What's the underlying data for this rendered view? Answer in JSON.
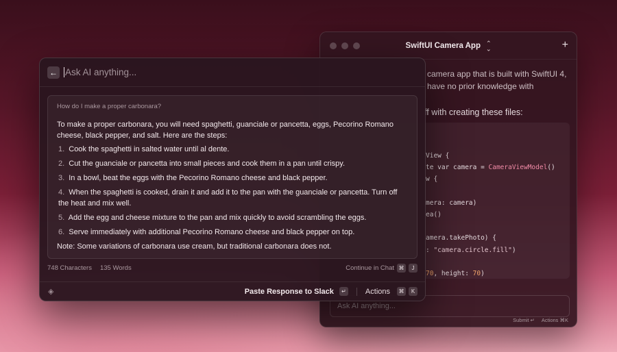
{
  "chat_window": {
    "title": "SwiftUI Camera App",
    "intro_line1": "camera app that is built with SwiftUI 4,",
    "intro_line2": "have no prior knowledge with",
    "files_text": "ff with creating these files:",
    "code_lines": [
      "View {",
      "te var camera = CameraViewModel()",
      "w {",
      "",
      "mera: camera)",
      "ea()",
      "",
      "amera.takePhoto) {",
      ": \"camera.circle.fill\")",
      "",
      "70, height: 70)"
    ],
    "input_placeholder": "Ask AI anything...",
    "footer_submit": "Submit ↵",
    "footer_actions": "Actions ⌘K"
  },
  "ai_panel": {
    "input_placeholder": "Ask AI anything...",
    "question": "How do I make a proper carbonara?",
    "answer_intro": "To make a proper carbonara, you will need spaghetti, guanciale or pancetta, eggs, Pecorino Romano cheese, black pepper, and salt. Here are the steps:",
    "steps": [
      {
        "n": "1.",
        "text": "Cook the spaghetti in salted water until al dente."
      },
      {
        "n": "2.",
        "text": "Cut the guanciale or pancetta into small pieces and cook them in a pan until crispy."
      },
      {
        "n": "3.",
        "text": "In a bowl, beat the eggs with the Pecorino Romano cheese and black pepper."
      },
      {
        "n": "4.",
        "text": "When the spaghetti is cooked, drain it and add it to the pan with the guanciale or pancetta. Turn off the heat and mix well."
      },
      {
        "n": "5.",
        "text": "Add the egg and cheese mixture to the pan and mix quickly to avoid scrambling the eggs."
      },
      {
        "n": "6.",
        "text": "Serve immediately with additional Pecorino Romano cheese and black pepper on top."
      }
    ],
    "note": "Note: Some variations of carbonara use cream, but traditional carbonara does not.",
    "char_count": "748 Characters",
    "word_count": "135 Words",
    "continue_label": "Continue in Chat",
    "continue_keys": [
      "⌘",
      "J"
    ],
    "primary_action": "Paste Response to Slack",
    "primary_key": "↵",
    "actions_label": "Actions",
    "actions_keys": [
      "⌘",
      "K"
    ]
  },
  "icons": {
    "back": "arrow-left-icon",
    "extension": "extension-icon",
    "plus": "plus-icon",
    "chevrons": "chevron-up-down-icon"
  }
}
